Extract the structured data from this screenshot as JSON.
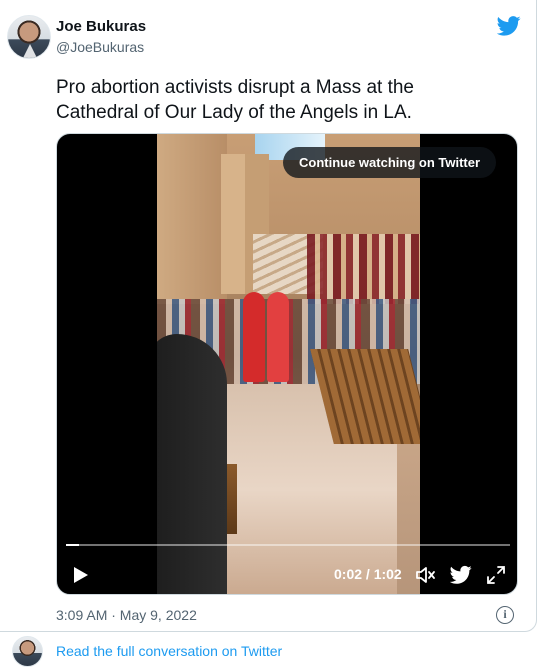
{
  "tweet": {
    "author_name": "Joe Bukuras",
    "author_handle": "@JoeBukuras",
    "text": "Pro abortion activists disrupt a Mass at the Cathedral of Our Lady of the Angels in LA.",
    "timestamp": "3:09 AM · May 9, 2022",
    "read_more": "Read the full conversation on Twitter",
    "brand_color": "#1d9bf0"
  },
  "video": {
    "overlay_label": "Continue watching on Twitter",
    "time_display": "0:02 / 1:02",
    "progress": 0.03,
    "controls": {
      "play_icon": "play-icon",
      "volume_icon": "volume-icon",
      "twitter_icon": "twitter-bird-icon",
      "fullscreen_icon": "expand-icon"
    }
  },
  "icons": {
    "info": "i"
  }
}
